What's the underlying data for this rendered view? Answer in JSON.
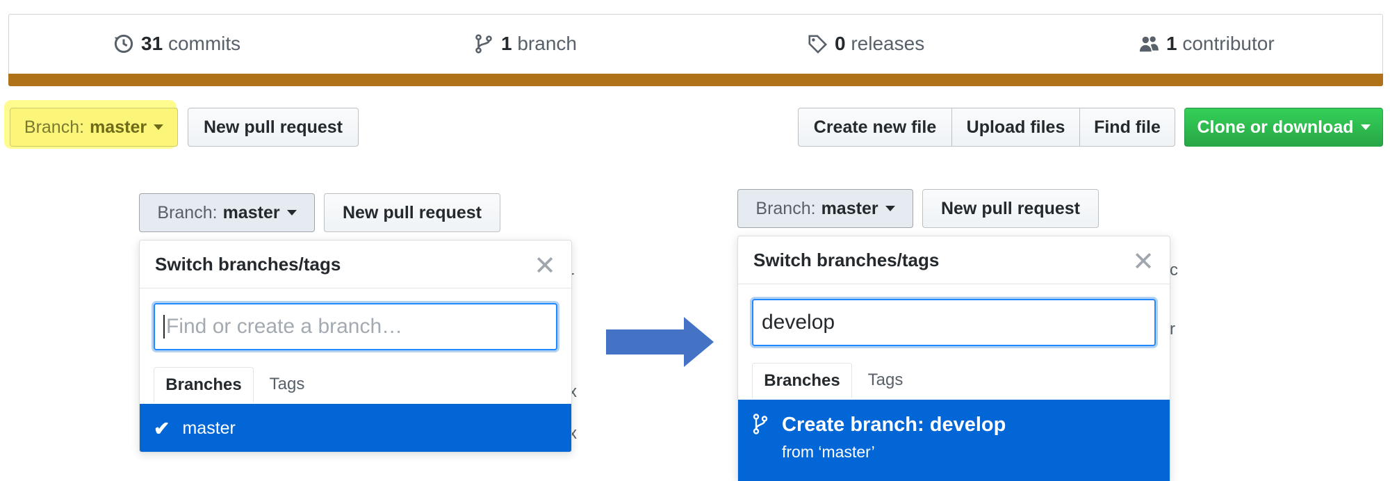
{
  "stats": {
    "commits": {
      "count": "31",
      "label": "commits",
      "icon": "history-icon"
    },
    "branches": {
      "count": "1",
      "label": "branch",
      "icon": "git-branch-icon"
    },
    "releases": {
      "count": "0",
      "label": "releases",
      "icon": "tag-icon"
    },
    "contributors": {
      "count": "1",
      "label": "contributor",
      "icon": "people-icon"
    },
    "language_color": "#b07219"
  },
  "toolbar": {
    "branch_prefix": "Branch:",
    "branch_name": "master",
    "new_pull_request": "New pull request",
    "create_new_file": "Create new file",
    "upload_files": "Upload files",
    "find_file": "Find file",
    "clone_or_download": "Clone or download"
  },
  "left_dropdown": {
    "branch_prefix": "Branch:",
    "branch_name": "master",
    "new_pull_request": "New pull request",
    "title": "Switch branches/tags",
    "filter_placeholder": "Find or create a branch…",
    "tab_branches": "Branches",
    "tab_tags": "Tags",
    "selected_branch": "master"
  },
  "right_dropdown": {
    "branch_prefix": "Branch:",
    "branch_name": "master",
    "new_pull_request": "New pull request",
    "title": "Switch branches/tags",
    "filter_value": "develop",
    "tab_branches": "Branches",
    "tab_tags": "Tags",
    "create_label": "Create branch: develop",
    "create_sub": "from ‘master’"
  },
  "colors": {
    "accent_blue": "#0366d6",
    "clone_green": "#28a745",
    "highlight_yellow": "#fefb7a",
    "arrow_blue": "#4472c4"
  }
}
